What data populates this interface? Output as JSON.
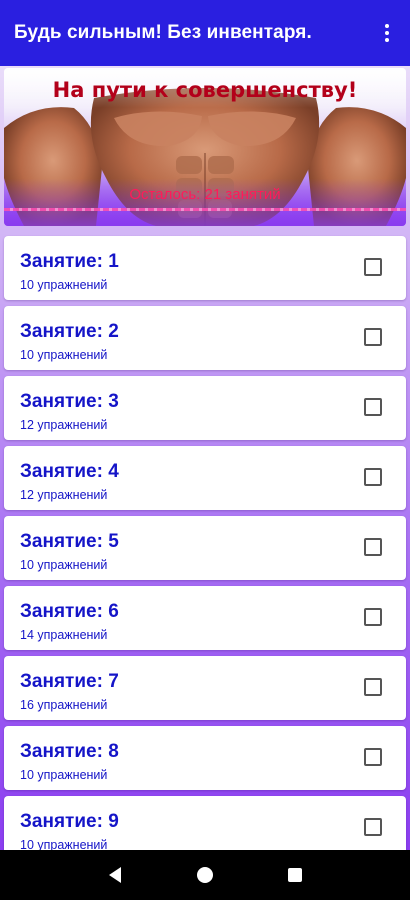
{
  "app_bar": {
    "title": "Будь сильным! Без инвентаря.",
    "overflow_icon": "more-vert-icon"
  },
  "banner": {
    "title": "На пути к совершенству!",
    "subtitle": "Осталось: 21 занятий"
  },
  "lessons": [
    {
      "title": "Занятие: 1",
      "count": "10 упражнений",
      "checked": false
    },
    {
      "title": "Занятие: 2",
      "count": "10 упражнений",
      "checked": false
    },
    {
      "title": "Занятие: 3",
      "count": "12 упражнений",
      "checked": false
    },
    {
      "title": "Занятие: 4",
      "count": "12 упражнений",
      "checked": false
    },
    {
      "title": "Занятие: 5",
      "count": "10 упражнений",
      "checked": false
    },
    {
      "title": "Занятие: 6",
      "count": "14 упражнений",
      "checked": false
    },
    {
      "title": "Занятие: 7",
      "count": "16 упражнений",
      "checked": false
    },
    {
      "title": "Занятие: 8",
      "count": "10 упражнений",
      "checked": false
    },
    {
      "title": "Занятие: 9",
      "count": "10 упражнений",
      "checked": false
    }
  ],
  "nav": {
    "back_icon": "back-triangle-icon",
    "home_icon": "home-circle-icon",
    "recents_icon": "recents-square-icon"
  },
  "colors": {
    "app_bar": "#2a1fe0",
    "lesson_text": "#1515c8",
    "banner_title": "#b3001a",
    "banner_subtitle": "#ff1a5a"
  }
}
